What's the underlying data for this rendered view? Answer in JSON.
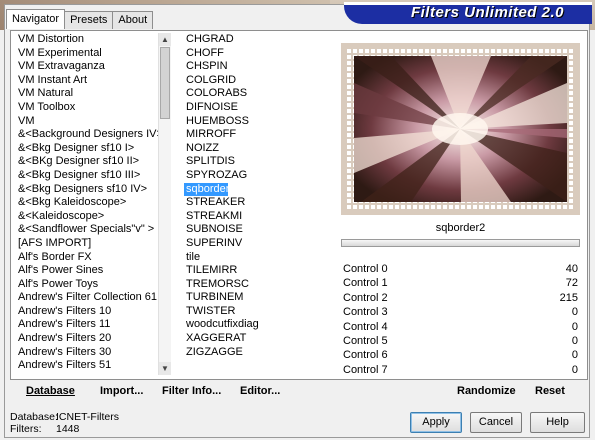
{
  "window": {
    "banner_title": "Filters Unlimited 2.0"
  },
  "tabs": [
    {
      "label": "Navigator",
      "active": true
    },
    {
      "label": "Presets",
      "active": false
    },
    {
      "label": "About",
      "active": false
    }
  ],
  "categories": [
    "VM Distortion",
    "VM Experimental",
    "VM Extravaganza",
    "VM Instant Art",
    "VM Natural",
    "VM Toolbox",
    "VM",
    "&<Background Designers IV>",
    "&<Bkg Designer sf10 I>",
    "&<BKg Designer sf10 II>",
    "&<Bkg Designer sf10 III>",
    "&<Bkg Designers sf10 IV>",
    "&<Bkg Kaleidoscope>",
    "&<Kaleidoscope>",
    "&<Sandflower Specials\"v\" >",
    "[AFS IMPORT]",
    "Alf's Border FX",
    "Alf's Power Sines",
    "Alf's Power Toys",
    "Andrew's Filter Collection 61",
    "Andrew's Filters 10",
    "Andrew's Filters 11",
    "Andrew's Filters 20",
    "Andrew's Filters 30",
    "Andrew's Filters 51"
  ],
  "filters": [
    "CHGRAD",
    "CHOFF",
    "CHSPIN",
    "COLGRID",
    "COLORABS",
    "DIFNOISE",
    "HUEMBOSS",
    "MIRROFF",
    "NOIZZ",
    "SPLITDIS",
    "SPYROZAG",
    "sqborder2",
    "STREAKER",
    "STREAKMI",
    "SUBNOISE",
    "SUPERINV",
    "tile",
    "TILEMIRR",
    "TREMORSC",
    "TURBINEM",
    "TWISTER",
    "woodcutfixdiag",
    "XAGGERAT",
    "ZIGZAGGE"
  ],
  "selected_filter": "sqborder2",
  "controls": [
    {
      "label": "Control 0",
      "value": "40"
    },
    {
      "label": "Control 1",
      "value": "72"
    },
    {
      "label": "Control 2",
      "value": "215"
    },
    {
      "label": "Control 3",
      "value": "0"
    },
    {
      "label": "Control 4",
      "value": "0"
    },
    {
      "label": "Control 5",
      "value": "0"
    },
    {
      "label": "Control 6",
      "value": "0"
    },
    {
      "label": "Control 7",
      "value": "0"
    }
  ],
  "actions": {
    "database": "Database",
    "import": "Import...",
    "filter_info": "Filter Info...",
    "editor": "Editor...",
    "randomize": "Randomize",
    "reset": "Reset"
  },
  "info": {
    "database_label": "Database:",
    "database_value": "ICNET-Filters",
    "filters_label": "Filters:",
    "filters_value": "1448"
  },
  "buttons": {
    "apply": "Apply",
    "cancel": "Cancel",
    "help": "Help"
  },
  "colors": {
    "banner": "#1c2ea3",
    "selection": "#3399ff"
  }
}
